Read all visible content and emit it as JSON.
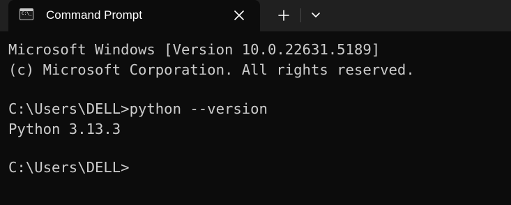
{
  "tab": {
    "title": "Command Prompt",
    "icon": "cmd-icon",
    "icon_text": "C:\\_"
  },
  "toolbar": {
    "new_tab_icon": "plus-icon",
    "dropdown_icon": "chevron-down-icon",
    "close_icon": "close-icon"
  },
  "terminal": {
    "lines": [
      "Microsoft Windows [Version 10.0.22631.5189]",
      "(c) Microsoft Corporation. All rights reserved.",
      "",
      "C:\\Users\\DELL>python --version",
      "Python 3.13.3",
      "",
      "C:\\Users\\DELL>"
    ]
  },
  "colors": {
    "tab_strip": "#202020",
    "terminal_background": "#0c0c0c",
    "terminal_text": "#cccccc",
    "title_text": "#ffffff"
  }
}
